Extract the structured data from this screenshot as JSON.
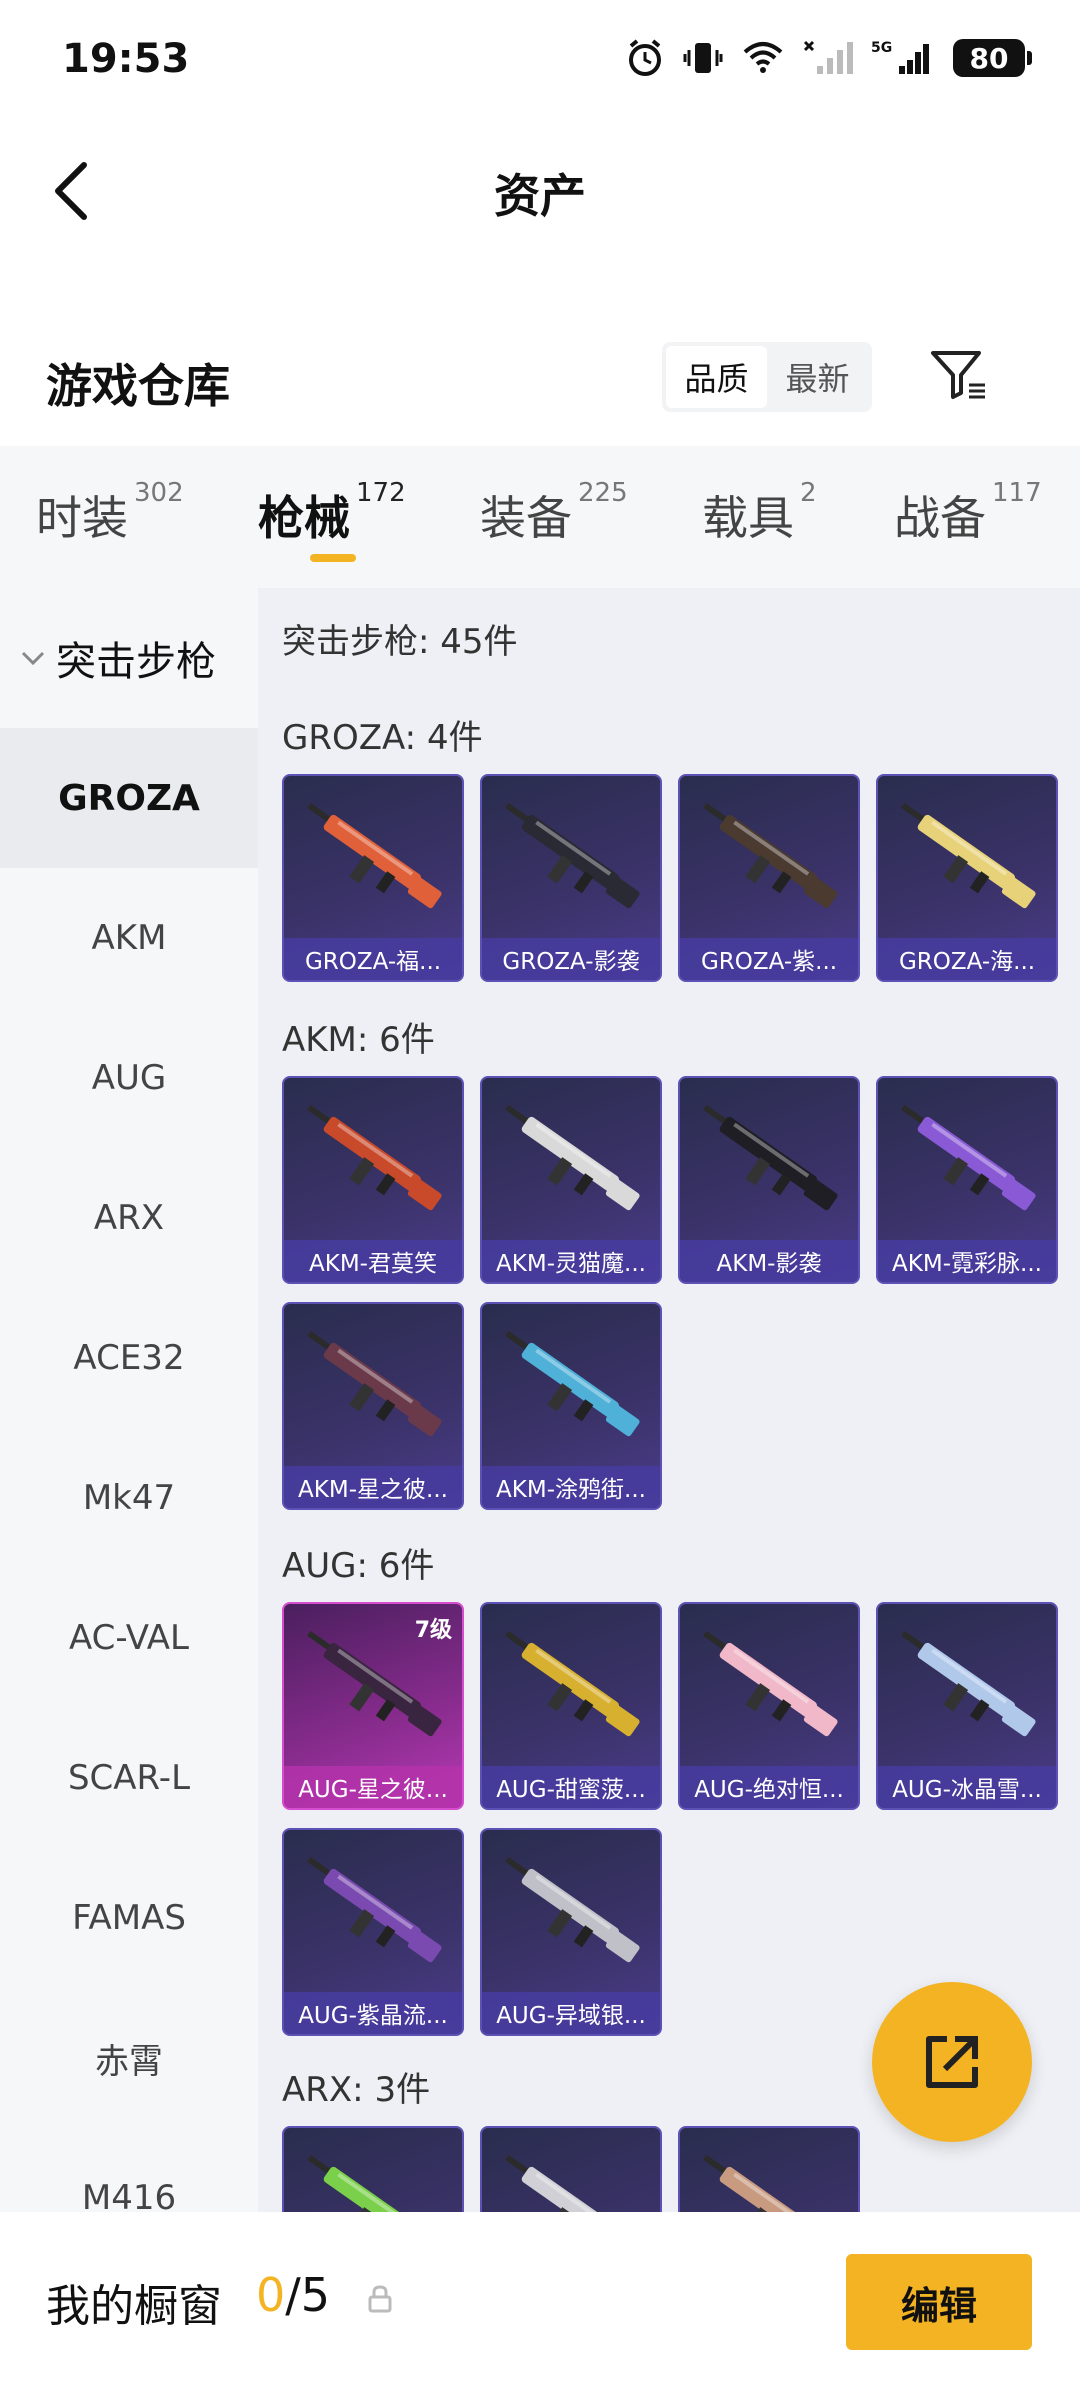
{
  "status_bar": {
    "time": "19:53",
    "battery": "80",
    "network": "5G",
    "icons": [
      "alarm-icon",
      "vibrate-icon",
      "wifi-icon",
      "signal-off-icon",
      "signal-5g-icon"
    ]
  },
  "header": {
    "title": "资产",
    "back_icon": "back-arrow-icon"
  },
  "warehouse": {
    "title": "游戏仓库",
    "sort_options": [
      "品质",
      "最新"
    ],
    "sort_selected": "品质",
    "filter_icon": "filter-icon"
  },
  "tabs": [
    {
      "label": "时装",
      "count": "302"
    },
    {
      "label": "枪械",
      "count": "172"
    },
    {
      "label": "装备",
      "count": "225"
    },
    {
      "label": "载具",
      "count": "2"
    },
    {
      "label": "战备",
      "count": "117"
    }
  ],
  "active_tab": "枪械",
  "sidebar": {
    "group_label": "突击步枪",
    "items": [
      "GROZA",
      "AKM",
      "AUG",
      "ARX",
      "ACE32",
      "Mk47",
      "AC-VAL",
      "SCAR-L",
      "FAMAS",
      "赤霄",
      "M416"
    ],
    "active_item": "GROZA"
  },
  "main": {
    "summary": "突击步枪: 45件",
    "sections": [
      {
        "title": "GROZA: 4件",
        "items": [
          {
            "name": "GROZA-福...",
            "color": "#e0603a"
          },
          {
            "name": "GROZA-影袭",
            "color": "#2a2a35"
          },
          {
            "name": "GROZA-紫...",
            "color": "#4a3a30"
          },
          {
            "name": "GROZA-海...",
            "color": "#e7d27a"
          }
        ]
      },
      {
        "title": "AKM: 6件",
        "items": [
          {
            "name": "AKM-君莫笑",
            "color": "#c84a2a"
          },
          {
            "name": "AKM-灵猫魔...",
            "color": "#d9d9d9"
          },
          {
            "name": "AKM-影袭",
            "color": "#1e1e24"
          },
          {
            "name": "AKM-霓彩脉...",
            "color": "#8a5ad6"
          },
          {
            "name": "AKM-星之彼...",
            "color": "#6a3a4a"
          },
          {
            "name": "AKM-涂鸦街...",
            "color": "#4fb0d8"
          }
        ]
      },
      {
        "title": "AUG: 6件",
        "items": [
          {
            "name": "AUG-星之彼...",
            "color": "#3a2540",
            "level": "7级"
          },
          {
            "name": "AUG-甜蜜菠...",
            "color": "#d7b030"
          },
          {
            "name": "AUG-绝对恒...",
            "color": "#f0b8c8"
          },
          {
            "name": "AUG-冰晶雪...",
            "color": "#b0c8ea"
          },
          {
            "name": "AUG-紫晶流...",
            "color": "#7a4ab0"
          },
          {
            "name": "AUG-异域银...",
            "color": "#c0c0c8"
          }
        ]
      },
      {
        "title": "ARX: 3件",
        "items": [
          {
            "name": "",
            "color": "#7ad04a"
          },
          {
            "name": "",
            "color": "#d0d0d6"
          },
          {
            "name": "",
            "color": "#c89a80"
          }
        ]
      }
    ]
  },
  "fab": {
    "icon": "share-export-icon"
  },
  "bottom_bar": {
    "label": "我的橱窗",
    "current": "0",
    "separator": "/",
    "total": "5",
    "lock_icon": "lock-icon",
    "edit_label": "编辑"
  },
  "colors": {
    "accent": "#f4b322",
    "card_border": "#5c52b5",
    "card_highlight": "#d64ed0"
  }
}
